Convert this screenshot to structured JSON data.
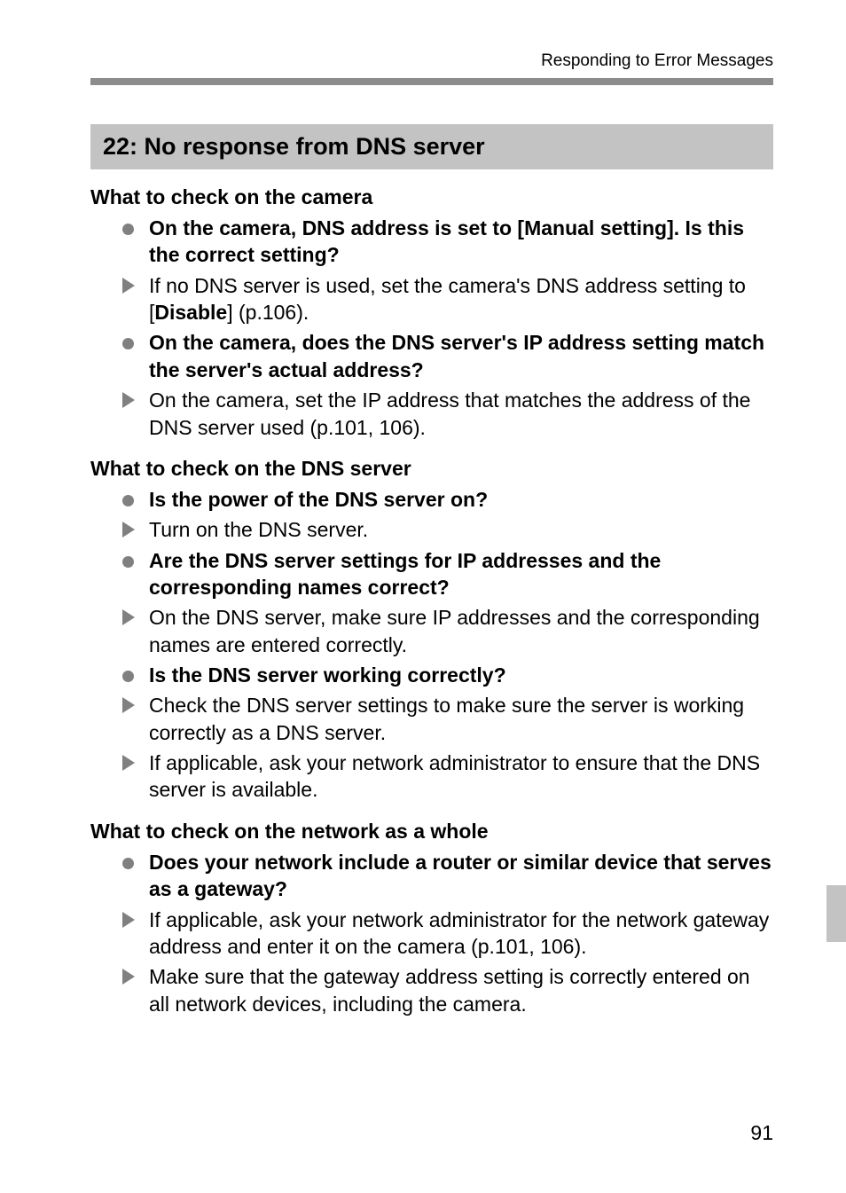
{
  "running_head": "Responding to Error Messages",
  "error_title": "22: No response from DNS server",
  "sections": [
    {
      "heading": "What to check on the camera",
      "items": [
        {
          "kind": "dot",
          "bold": true,
          "text": "On the camera, DNS address is set to [Manual setting]. Is this the correct setting?"
        },
        {
          "kind": "arrow",
          "bold": false,
          "text_pre": "If no DNS server is used, set the camera's DNS address setting to [",
          "bold_mid": "Disable",
          "text_post": "] (p.106)."
        },
        {
          "kind": "dot",
          "bold": true,
          "text": "On the camera, does the DNS server's IP address setting match the server's actual address?"
        },
        {
          "kind": "arrow",
          "bold": false,
          "text": "On the camera, set the IP address that matches the address of the DNS server used (p.101, 106)."
        }
      ]
    },
    {
      "heading": "What to check on the DNS server",
      "items": [
        {
          "kind": "dot",
          "bold": true,
          "text": "Is the power of the DNS server on?"
        },
        {
          "kind": "arrow",
          "bold": false,
          "text": "Turn on the DNS server."
        },
        {
          "kind": "dot",
          "bold": true,
          "text": "Are the DNS server settings for IP addresses and the corresponding names correct?"
        },
        {
          "kind": "arrow",
          "bold": false,
          "text": "On the DNS server, make sure IP addresses and the corresponding names are entered correctly."
        },
        {
          "kind": "dot",
          "bold": true,
          "text": "Is the DNS server working correctly?"
        },
        {
          "kind": "arrow",
          "bold": false,
          "text": "Check the DNS server settings to make sure the server is working correctly as a DNS server."
        },
        {
          "kind": "arrow",
          "bold": false,
          "text": "If applicable, ask your network administrator to ensure that the DNS server is available."
        }
      ]
    },
    {
      "heading": "What to check on the network as a whole",
      "items": [
        {
          "kind": "dot",
          "bold": true,
          "text": "Does your network include a router or similar device that serves as a gateway?"
        },
        {
          "kind": "arrow",
          "bold": false,
          "text": "If applicable, ask your network administrator for the network gateway address and enter it on the camera (p.101, 106)."
        },
        {
          "kind": "arrow",
          "bold": false,
          "text": "Make sure that the gateway address setting is correctly entered on all network devices, including the camera."
        }
      ]
    }
  ],
  "page_number": "91"
}
